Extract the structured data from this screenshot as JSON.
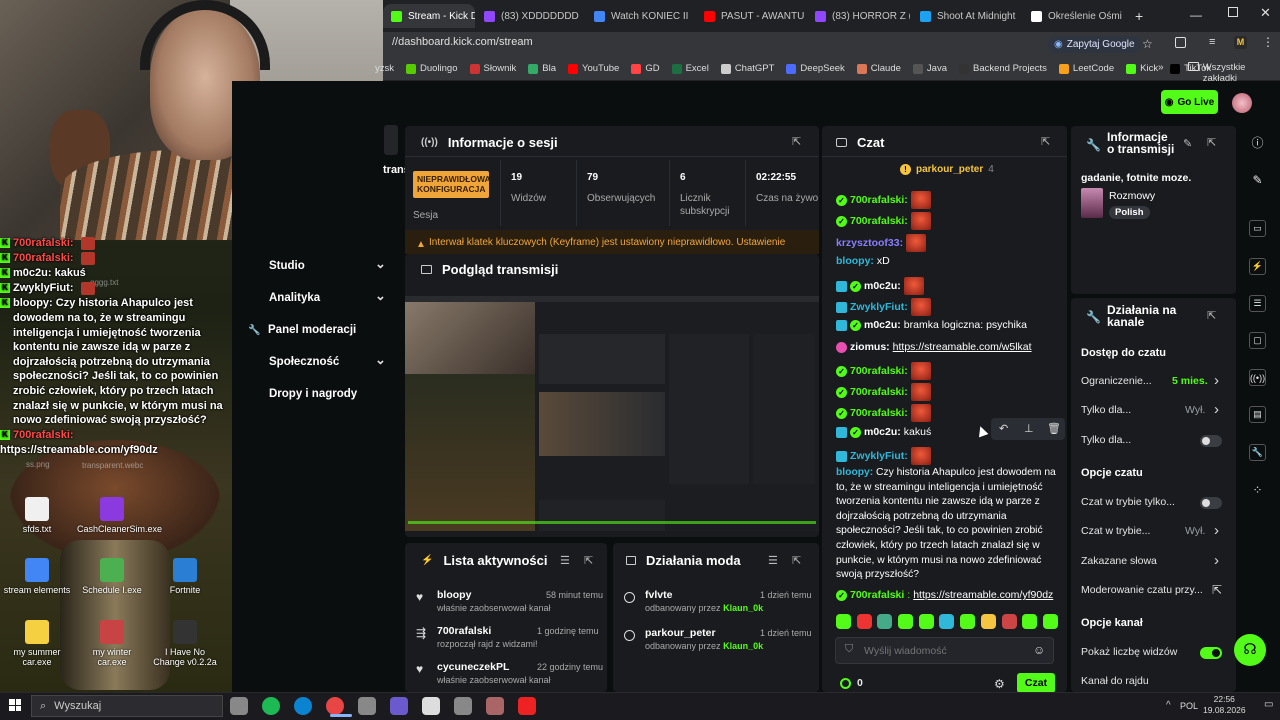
{
  "browser": {
    "tabs": [
      {
        "label": "Stream - Kick Da",
        "active": true,
        "color": "#53fc18"
      },
      {
        "label": "(83) XDDDDDDD",
        "color": "#9147ff"
      },
      {
        "label": "Watch KONIEC II",
        "color": "#4285f4"
      },
      {
        "label": "PASUT - AWANTU",
        "color": "#ff0000"
      },
      {
        "label": "(83) HORROR Z (",
        "color": "#9147ff"
      },
      {
        "label": "Shoot At Midnight",
        "color": "#1da1f2"
      },
      {
        "label": "Określenie Ośmi",
        "color": "#ffffff"
      }
    ],
    "url": "//dashboard.kick.com/stream",
    "zapytaj": "Zapytaj Google",
    "bookmarks": [
      "yzsk",
      "Duolingo",
      "Słownik",
      "Bla",
      "YouTube",
      "GD",
      "Excel",
      "ChatGPT",
      "DeepSeek",
      "Claude",
      "Java",
      "Backend Projects",
      "LeetCode",
      "Kick",
      "TikTok"
    ],
    "all_bookmarks": "Wszystkie zakładki"
  },
  "topbar": {
    "go_live": "Go Live"
  },
  "overlay": {
    "messages": [
      {
        "name": "700rafalski:",
        "text": "",
        "emote": true,
        "red": true
      },
      {
        "name": "700rafalski:",
        "text": "",
        "emote": true,
        "red": true
      },
      {
        "name": "m0c2u:",
        "text": "kakuś",
        "emote": false,
        "red": false
      },
      {
        "name": "ZwyklyFiut:",
        "text": "",
        "emote": true,
        "red": false
      },
      {
        "name": "bloopy:",
        "text": "Czy historia Ahapulco jest dowodem na to, że w streamingu inteligencja i umiejętność tworzenia kontentu nie zawsze idą w parze z dojrzałością potrzebną do utrzymania społeczności? Jeśli tak, to co powinien zrobić człowiek, który po trzech latach znalazł się w punkcie, w którym musi na nowo zdefiniować swoją przyszłość?",
        "emote": false,
        "red": false
      },
      {
        "name": "700rafalski:",
        "text": "",
        "emote": false,
        "red": true
      },
      {
        "name": "",
        "text": "https://streamable.com/yf90dz",
        "emote": false,
        "red": false
      }
    ],
    "desktop_icons": [
      {
        "label": "sfds.txt",
        "color": "#f0f0f0"
      },
      {
        "label": "CashCleanerSim.exe",
        "color": "#8a3adf"
      },
      {
        "label": "stream elements",
        "color": "#4285f4"
      },
      {
        "label": "Schedule I.exe",
        "color": "#4caf50"
      },
      {
        "label": "Fortnite",
        "color": "#2a7fd4"
      },
      {
        "label": "my summer car.exe",
        "color": "#f5d142"
      },
      {
        "label": "my winter car.exe",
        "color": "#c84444"
      },
      {
        "label": "I Have No Change v0.2.2a",
        "color": "#333333"
      }
    ],
    "bg_labels": [
      "gggg.txt",
      "ss.png",
      "transparent.webc"
    ]
  },
  "sidebar": {
    "items": [
      {
        "label": "Studio",
        "icon": "studio-icon",
        "chevron": true
      },
      {
        "label": "Analityka",
        "icon": "chart-icon",
        "chevron": true
      },
      {
        "label": "Panel moderacji",
        "icon": "wrench-icon",
        "chevron": false
      },
      {
        "label": "Społeczność",
        "icon": "community-icon",
        "chevron": true
      },
      {
        "label": "Dropy i nagrody",
        "icon": "drops-icon",
        "chevron": false
      }
    ],
    "partial_label": "transmis"
  },
  "session": {
    "title": "Informacje o sesji",
    "badge": "NIEPRAWIDŁOWA KONFIGURACJA",
    "badge_label": "Sesja",
    "stats": [
      {
        "value": "19",
        "label": "Widzów"
      },
      {
        "value": "79",
        "label": "Obserwujących"
      },
      {
        "value": "6",
        "label": "Licznik subskrypcji"
      },
      {
        "value": "02:22:55",
        "label": "Czas na żywo"
      }
    ],
    "warning": "Interwał klatek kluczowych (Keyframe) jest ustawiony nieprawidłowo. Ustawienie"
  },
  "preview": {
    "title": "Podgląd transmisji"
  },
  "activity": {
    "title": "Lista aktywności",
    "items": [
      {
        "name": "bloopy",
        "action": "właśnie zaobserwował kanał",
        "time": "58 minut temu"
      },
      {
        "name": "700rafalski",
        "action": "rozpoczął rajd z widzami!",
        "time": "1 godzinę temu"
      },
      {
        "name": "cycuneczekPL",
        "action": "właśnie zaobserwował kanał",
        "time": "22 godziny temu"
      }
    ]
  },
  "mod": {
    "title": "Działania moda",
    "items": [
      {
        "name": "fvlvte",
        "action_prefix": "odbanowany przez",
        "by": "Klaun_0k",
        "time": "1 dzień temu"
      },
      {
        "name": "parkour_peter",
        "action_prefix": "odbanowany przez",
        "by": "Klaun_0k",
        "time": "1 dzień temu"
      }
    ]
  },
  "chat": {
    "title": "Czat",
    "pinned_user": "parkour_peter",
    "pinned_count": "4",
    "messages": [
      {
        "name": "700rafalski",
        "color": "#53fc18",
        "text": "",
        "emote": true,
        "badge": "green"
      },
      {
        "name": "700rafalski",
        "color": "#53fc18",
        "text": "",
        "emote": true,
        "badge": "green"
      },
      {
        "name": "krzysztoof33",
        "color": "#8a7dff",
        "text": "",
        "emote": true,
        "badge": ""
      },
      {
        "name": "bloopy",
        "color": "#2fb8d9",
        "text": "xD",
        "emote": false,
        "badge": ""
      },
      {
        "name": "m0c2u",
        "color": "#ffffff",
        "text": "",
        "emote": true,
        "badge": "subgreen"
      },
      {
        "name": "ZwyklyFiut",
        "color": "#2fb8d9",
        "text": "",
        "emote": true,
        "badge": "sub"
      },
      {
        "name": "m0c2u",
        "color": "#ffffff",
        "text": "bramka logiczna: psychika",
        "emote": false,
        "badge": "subgreen"
      },
      {
        "name": "ziomus",
        "color": "#ffffff",
        "text": "https://streamable.com/w5lkat",
        "emote": false,
        "badge": "pink",
        "link": true
      },
      {
        "name": "700rafalski",
        "color": "#53fc18",
        "text": "",
        "emote": true,
        "badge": "green"
      },
      {
        "name": "700rafalski",
        "color": "#53fc18",
        "text": "",
        "emote": true,
        "badge": "green"
      },
      {
        "name": "700rafalski",
        "color": "#53fc18",
        "text": "",
        "emote": true,
        "badge": "green"
      },
      {
        "name": "m0c2u",
        "color": "#ffffff",
        "text": "kakuś",
        "emote": false,
        "badge": "subgreen"
      },
      {
        "name": "ZwyklyFiut",
        "color": "#2fb8d9",
        "text": "",
        "emote": true,
        "badge": "sub"
      }
    ],
    "long_msg": {
      "name": "bloopy",
      "lines": [
        "Czy historia Ahapulco jest dowodem na",
        "to, że w streamingu inteligencja i umiejętność",
        "tworzenia kontentu nie zawsze idą w parze z",
        "dojrzałością potrzebną do utrzymania",
        "społeczności? Jeśli tak, to co powinien zrobić",
        "człowiek, który po trzech latach znalazł się w",
        "punkcie, w którym musi na nowo zdefiniować",
        "swoją przyszłość?"
      ]
    },
    "last_msg": {
      "name": "700rafalski",
      "link": "https://streamable.com/yf90dz"
    },
    "input_placeholder": "Wyślij wiadomość",
    "count": "0",
    "send": "Czat"
  },
  "stream_info": {
    "title_line1": "Informacje",
    "title_line2": "o transmisji",
    "stream_title": "gadanie, fotnite moze.",
    "category": "Rozmowy",
    "tag": "Polish"
  },
  "channel_actions": {
    "title_line1": "Działania na",
    "title_line2": "kanale",
    "chat_access": "Dostęp do czatu",
    "rows1": [
      {
        "label": "Ograniczenie...",
        "value": "5 mies.",
        "type": "chevron",
        "green": true
      },
      {
        "label": "Tylko dla...",
        "value": "Wył.",
        "type": "chevron",
        "green": false
      },
      {
        "label": "Tylko dla...",
        "value": "",
        "type": "toggle",
        "on": false
      }
    ],
    "chat_options": "Opcje czatu",
    "rows2": [
      {
        "label": "Czat w trybie tylko...",
        "value": "",
        "type": "toggle",
        "on": false
      },
      {
        "label": "Czat w trybie...",
        "value": "Wył.",
        "type": "chevron",
        "green": false
      },
      {
        "label": "Zakazane słowa",
        "value": "",
        "type": "chevron",
        "green": false
      },
      {
        "label": "Moderowanie czatu przy...",
        "value": "",
        "type": "external",
        "green": false
      }
    ],
    "channel_options": "Opcje kanał",
    "rows3": [
      {
        "label": "Pokaż liczbę widzów",
        "value": "",
        "type": "toggle",
        "on": true
      },
      {
        "label": "Kanał do rajdu",
        "value": "",
        "type": "none"
      }
    ]
  },
  "taskbar": {
    "search": "Wyszukaj",
    "lang": "POL",
    "time": "22:56",
    "date": "19.08.2026"
  },
  "colors": {
    "accent": "#53fc18",
    "panel": "#191b1f",
    "bg": "#0b0e0f",
    "warning": "#f0a53a"
  }
}
